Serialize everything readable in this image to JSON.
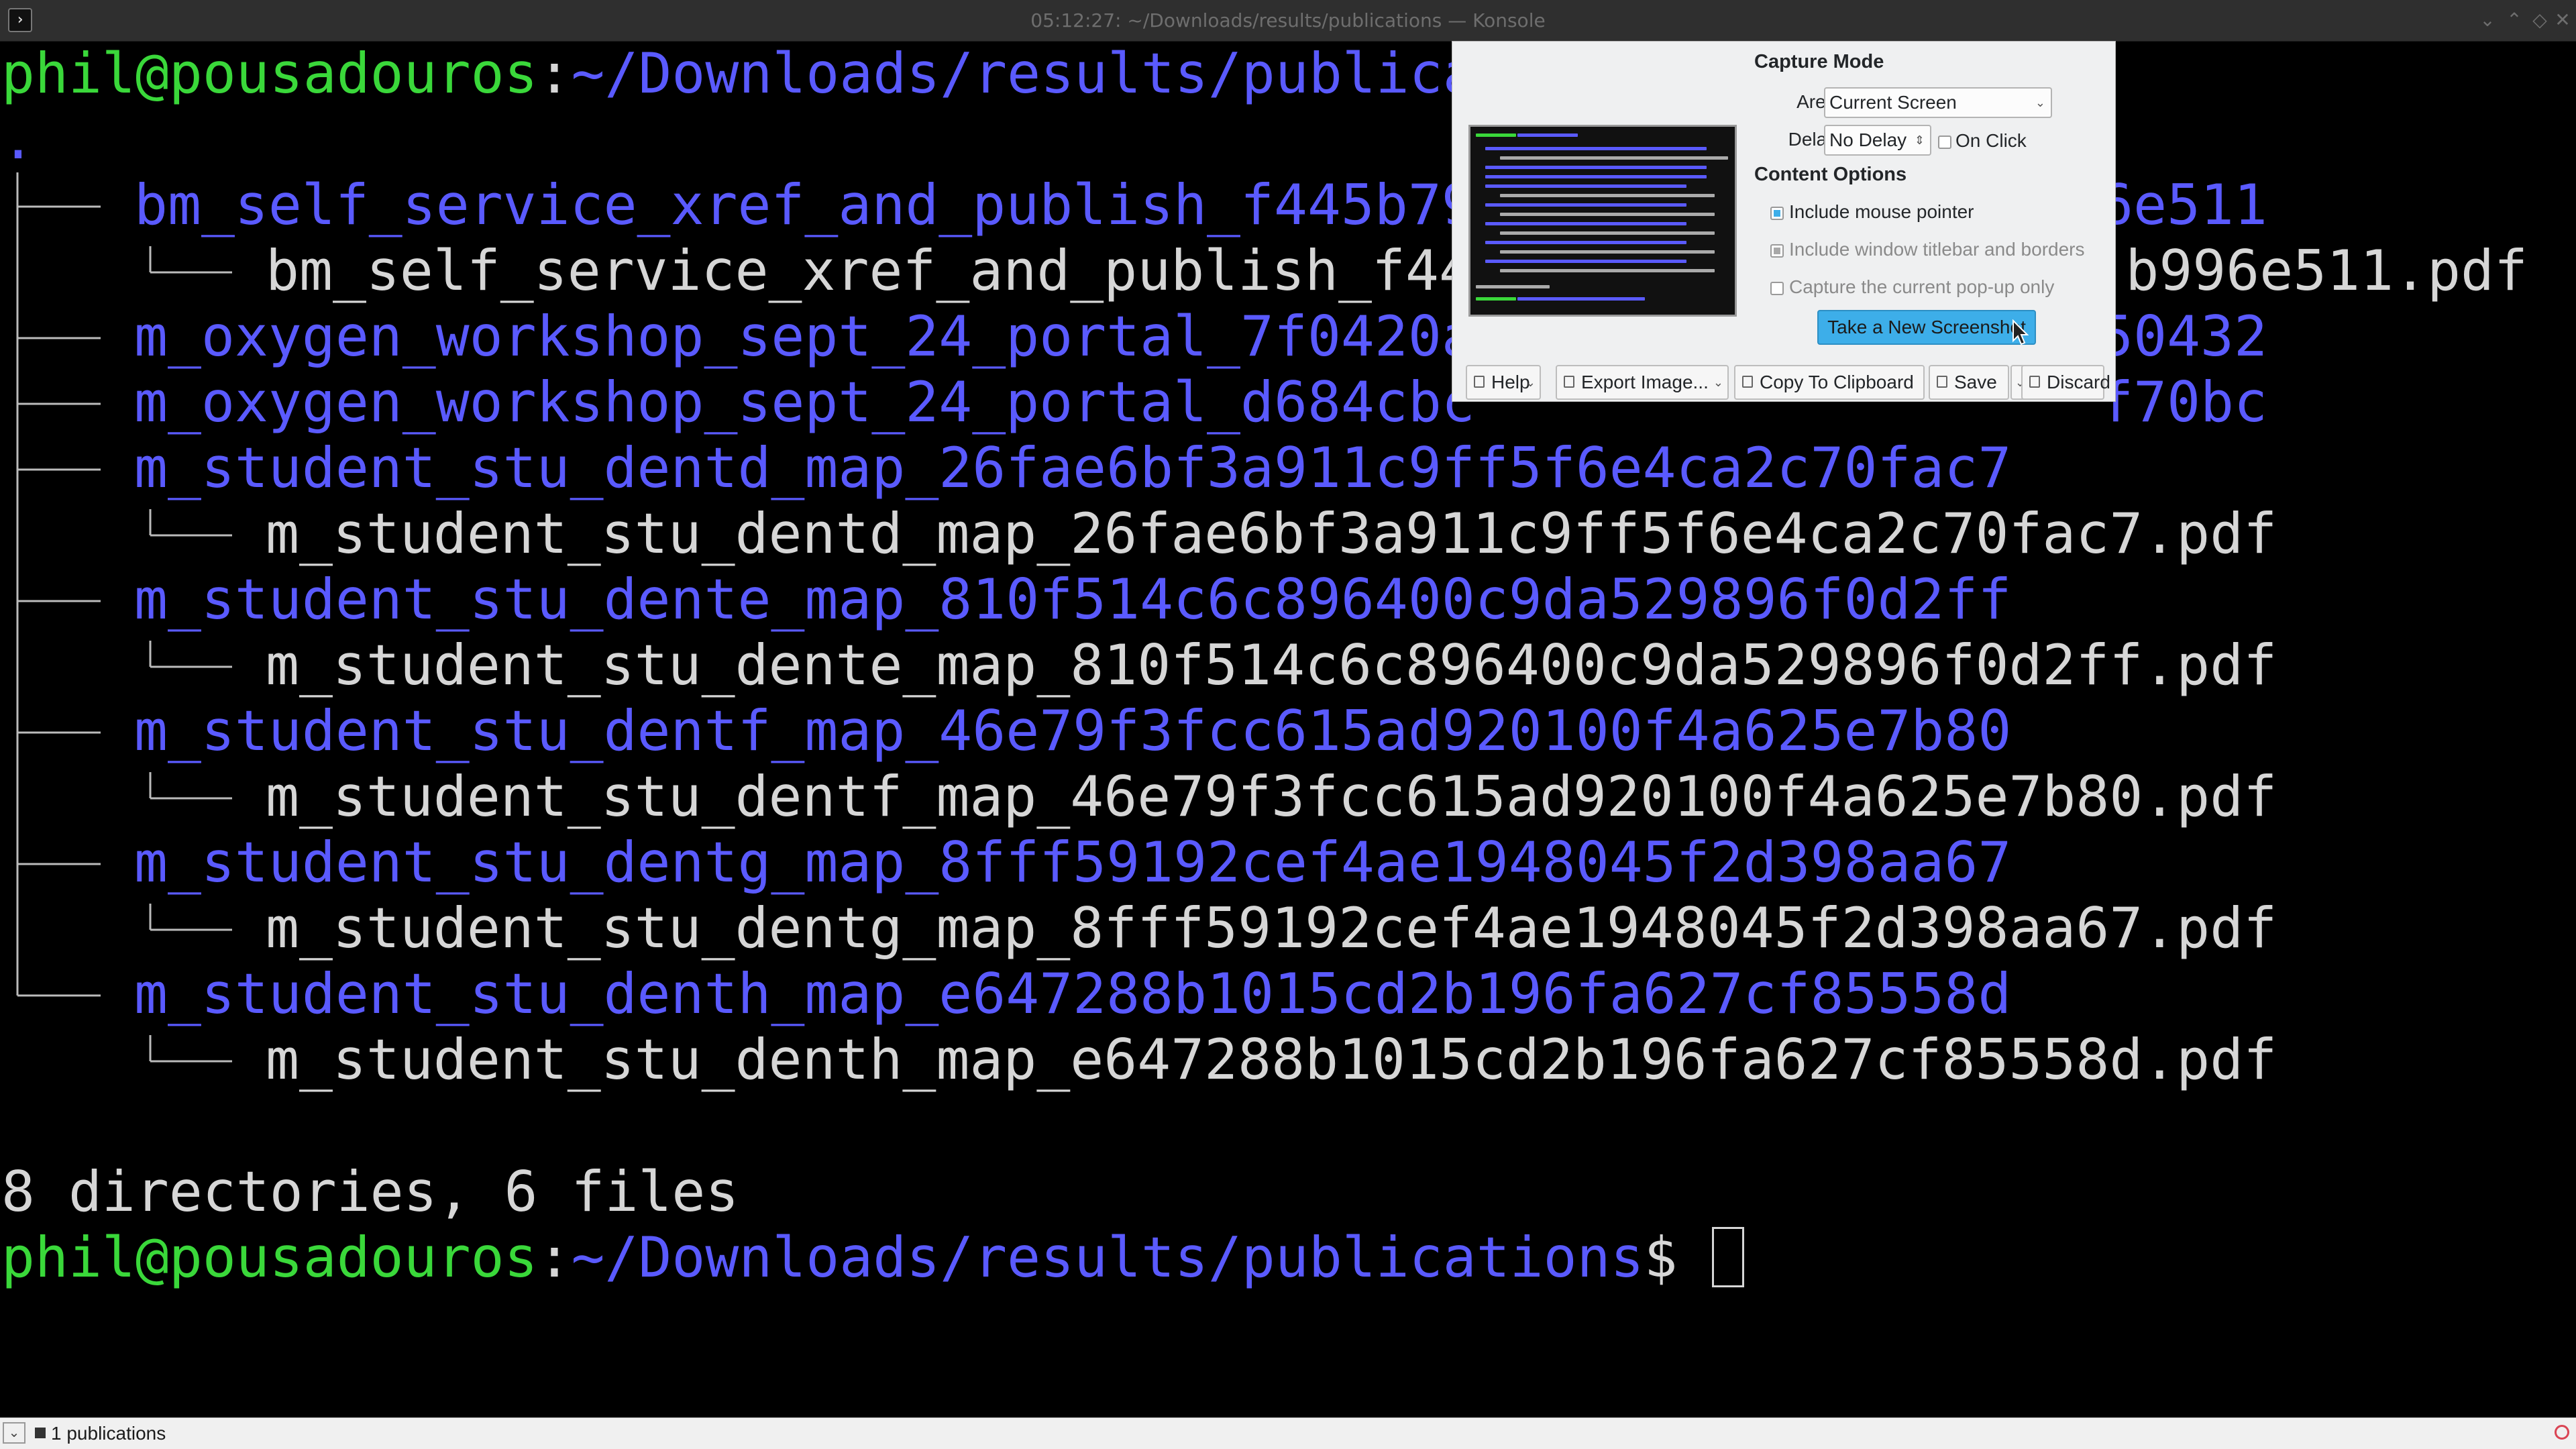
{
  "window": {
    "title": "05:12:27: ~/Downloads/results/publications — Konsole",
    "app_icon": "terminal-icon",
    "controls": [
      "chevron-down-icon",
      "chevron-up-icon",
      "diamond-icon",
      "close-icon"
    ]
  },
  "terminal": {
    "prompt1": {
      "user_host": "phil@pousadouros",
      "colon": ":",
      "path": "~/Downloads/results/publica"
    },
    "tree": {
      "root": ".",
      "rows": [
        {
          "depth": 1,
          "kind": "dir",
          "text": "bm_self_service_xref_and_publish_f445b79",
          "tail": "6e511"
        },
        {
          "depth": 2,
          "kind": "file",
          "text": "bm_self_service_xref_and_publish_f44",
          "tail": "b996e511.pdf"
        },
        {
          "depth": 1,
          "kind": "dir",
          "text": "m_oxygen_workshop_sept_24_portal_7f0420a",
          "tail": "50432"
        },
        {
          "depth": 1,
          "kind": "dir",
          "text": "m_oxygen_workshop_sept_24_portal_d684cbc",
          "tail": "f70bc"
        },
        {
          "depth": 1,
          "kind": "dir",
          "text": "m_student_stu_dentd_map_26fae6bf3a911c9ff5f6e4ca2c70fac7",
          "tail": ""
        },
        {
          "depth": 2,
          "kind": "file",
          "text": "m_student_stu_dentd_map_26fae6bf3a911c9ff5f6e4ca2c70fac7.pdf",
          "tail": ""
        },
        {
          "depth": 1,
          "kind": "dir",
          "text": "m_student_stu_dente_map_810f514c6c896400c9da529896f0d2ff",
          "tail": ""
        },
        {
          "depth": 2,
          "kind": "file",
          "text": "m_student_stu_dente_map_810f514c6c896400c9da529896f0d2ff.pdf",
          "tail": ""
        },
        {
          "depth": 1,
          "kind": "dir",
          "text": "m_student_stu_dentf_map_46e79f3fcc615ad920100f4a625e7b80",
          "tail": ""
        },
        {
          "depth": 2,
          "kind": "file",
          "text": "m_student_stu_dentf_map_46e79f3fcc615ad920100f4a625e7b80.pdf",
          "tail": ""
        },
        {
          "depth": 1,
          "kind": "dir",
          "text": "m_student_stu_dentg_map_8fff59192cef4ae1948045f2d398aa67",
          "tail": ""
        },
        {
          "depth": 2,
          "kind": "file",
          "text": "m_student_stu_dentg_map_8fff59192cef4ae1948045f2d398aa67.pdf",
          "tail": ""
        },
        {
          "depth": 1,
          "kind": "dir",
          "text": "m_student_stu_denth_map_e647288b1015cd2b196fa627cf85558d",
          "tail": ""
        },
        {
          "depth": 2,
          "kind": "file",
          "text": "m_student_stu_denth_map_e647288b1015cd2b196fa627cf85558d.pdf",
          "tail": ""
        }
      ]
    },
    "summary": "8 directories, 6 files",
    "prompt2": {
      "user_host": "phil@pousadouros",
      "colon": ":",
      "path": "~/Downloads/results/publications",
      "symbol": "$"
    },
    "colors": {
      "dir": "#5a5aff",
      "file": "#d6d6d6",
      "prompt": "#3ad83a",
      "bg": "#000000"
    }
  },
  "spectacle": {
    "capture_mode_heading": "Capture Mode",
    "area_label": "Area:",
    "area_value": "Current Screen",
    "delay_label": "Delay:",
    "delay_value": "No Delay",
    "on_click_label": "On Click",
    "on_click_checked": false,
    "content_options_heading": "Content Options",
    "include_pointer_label": "Include mouse pointer",
    "include_pointer_checked": true,
    "include_titlebar_label": "Include window titlebar and borders",
    "include_titlebar_checked": true,
    "popup_only_label": "Capture the current pop-up only",
    "popup_only_checked": false,
    "take_screenshot_label": "Take a New Screenshot",
    "buttons": {
      "help": "Help",
      "export": "Export Image...",
      "clipboard": "Copy To Clipboard",
      "save": "Save",
      "discard": "Discard"
    },
    "accent": "#3daee9"
  },
  "taskbar": {
    "tab_label": "1 publications"
  }
}
